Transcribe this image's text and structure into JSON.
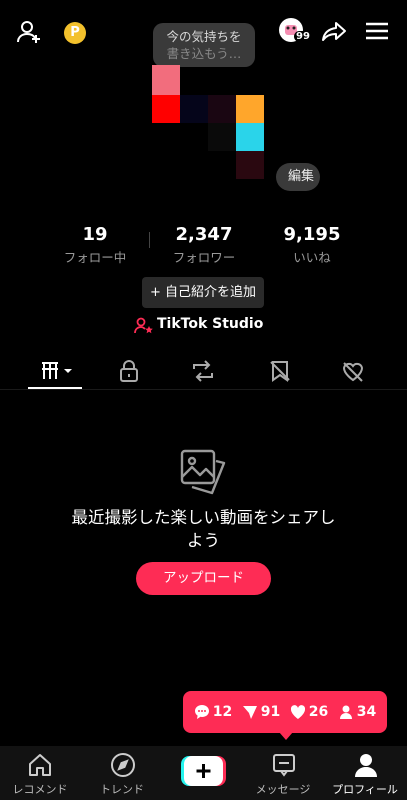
{
  "header": {
    "status_bubble_line1": "今の気持ちを",
    "status_bubble_line2": "書き込もう…",
    "coin_label": "P",
    "notification_count": "99"
  },
  "profile": {
    "edit_label": "編集",
    "stats": [
      {
        "value": "19",
        "label": "フォロー中"
      },
      {
        "value": "2,347",
        "label": "フォロワー"
      },
      {
        "value": "9,195",
        "label": "いいね"
      }
    ],
    "bio_button": "+ 自己紹介を追加",
    "studio_link": "TikTok Studio"
  },
  "tabs": [
    {
      "icon": "grid-icon",
      "active": true
    },
    {
      "icon": "lock-icon"
    },
    {
      "icon": "repost-icon"
    },
    {
      "icon": "bookmark-icon"
    },
    {
      "icon": "liked-icon"
    }
  ],
  "empty_state": {
    "message": "最近撮影した楽しい動画をシェアしよう",
    "upload_button": "アップロード"
  },
  "activity_popup": {
    "comments": "12",
    "shares": "91",
    "likes": "26",
    "followers": "34"
  },
  "nav": {
    "items": [
      "レコメンド",
      "トレンド",
      "",
      "メッセージ",
      "プロフィール"
    ]
  },
  "colors": {
    "accent": "#fe2c55",
    "background": "#000000",
    "pixel_avatar": [
      "#f26d7d",
      "#ff0000",
      "#ffa62b",
      "#2ad4ea",
      "#3a0a14",
      "#1a0a10"
    ]
  }
}
